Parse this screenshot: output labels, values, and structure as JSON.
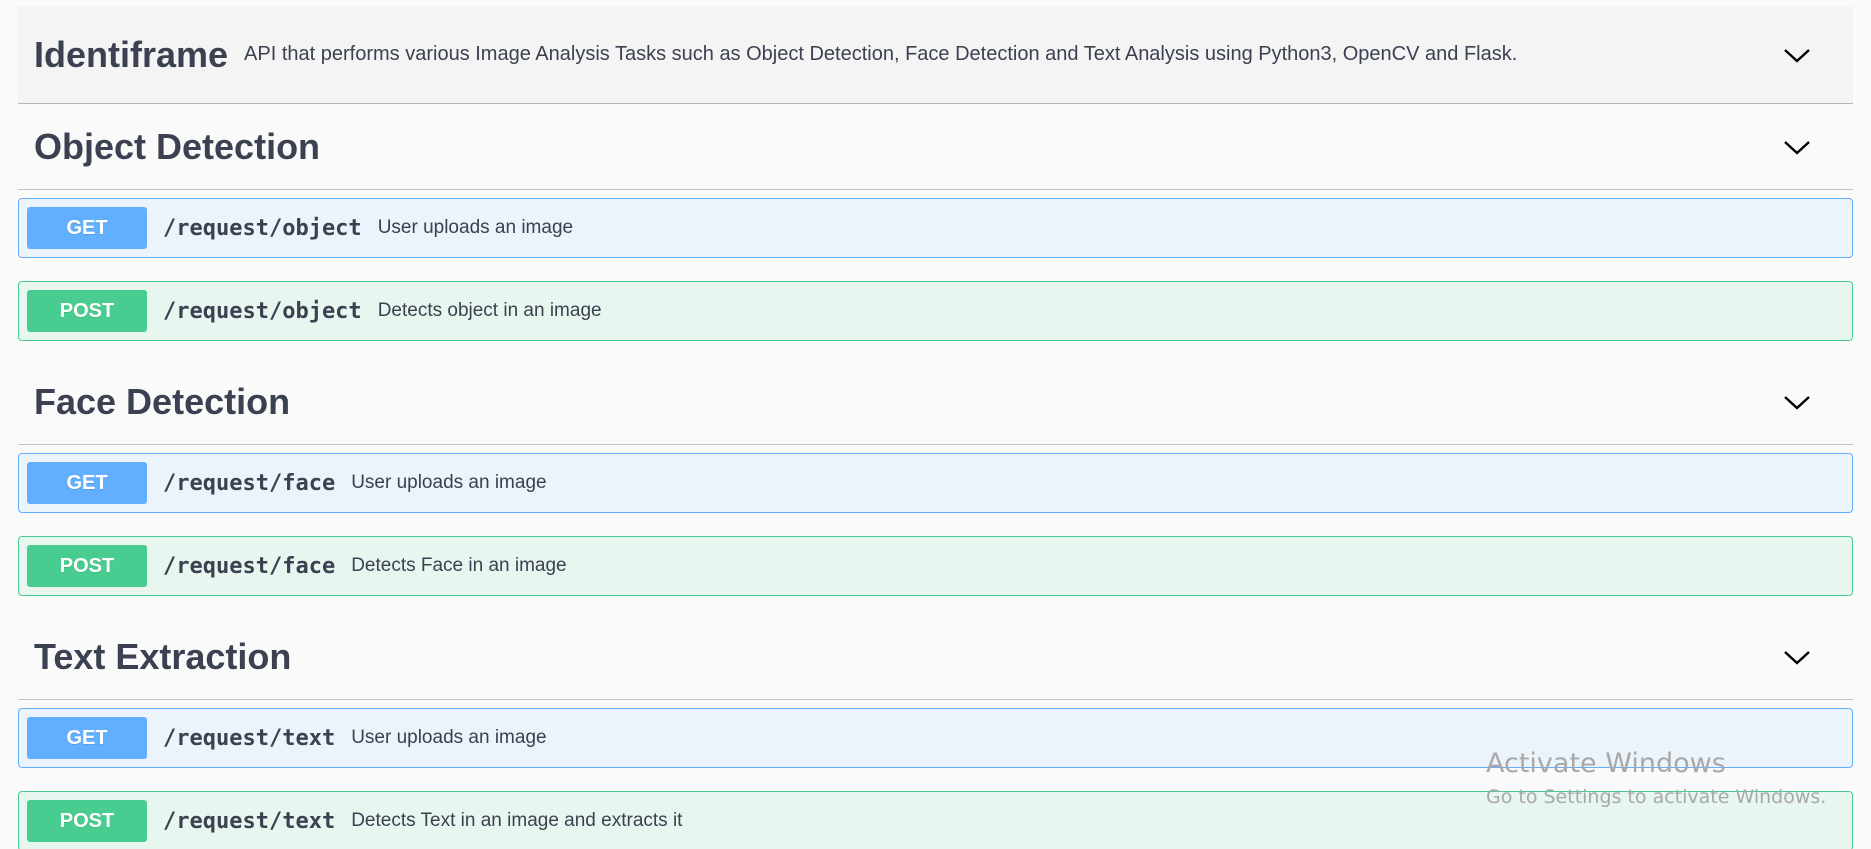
{
  "api": {
    "title": "Identiframe",
    "description": "API that performs various Image Analysis Tasks such as Object Detection, Face Detection and Text Analysis using Python3, OpenCV and Flask."
  },
  "colors": {
    "get": "#61affe",
    "post": "#49cc90",
    "get_bg": "#ebf3fb",
    "post_bg": "#e8f6f0",
    "text": "#3b4151"
  },
  "icons": {
    "toggle": "chevron-down-icon"
  },
  "sections": [
    {
      "title": "Object Detection",
      "ops": [
        {
          "method": "GET",
          "path": "/request/object",
          "summary": "User uploads an image"
        },
        {
          "method": "POST",
          "path": "/request/object",
          "summary": "Detects object in an image"
        }
      ]
    },
    {
      "title": "Face Detection",
      "ops": [
        {
          "method": "GET",
          "path": "/request/face",
          "summary": "User uploads an image"
        },
        {
          "method": "POST",
          "path": "/request/face",
          "summary": "Detects Face in an image"
        }
      ]
    },
    {
      "title": "Text Extraction",
      "ops": [
        {
          "method": "GET",
          "path": "/request/text",
          "summary": "User uploads an image"
        },
        {
          "method": "POST",
          "path": "/request/text",
          "summary": "Detects Text in an image and extracts it"
        }
      ]
    }
  ],
  "watermark": {
    "title": "Activate Windows",
    "subtitle": "Go to Settings to activate Windows."
  }
}
